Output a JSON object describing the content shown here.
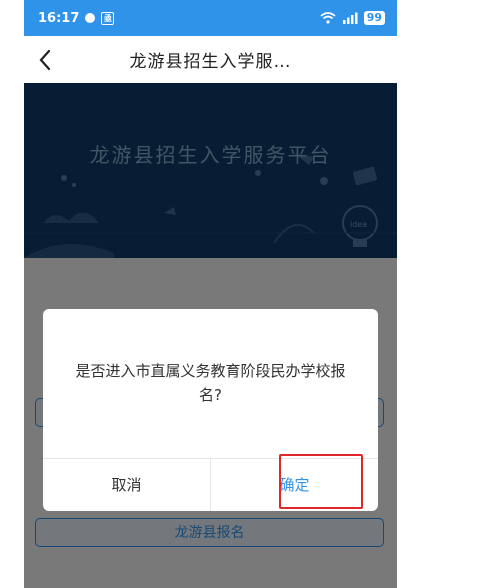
{
  "status_bar": {
    "time": "16:17",
    "app_badge": "亟",
    "signal": "4G",
    "battery": "99"
  },
  "navbar": {
    "title": "龙游县招生入学服…"
  },
  "banner": {
    "title": "龙游县招生入学服务平台",
    "bulb_text": "idea"
  },
  "content": {
    "bottom_button": "龙游县报名"
  },
  "dialog": {
    "message": "是否进入市直属义务教育阶段民办学校报名?",
    "cancel_label": "取消",
    "ok_label": "确定"
  },
  "colors": {
    "accent": "#2f93ea",
    "banner": "#0d3b66",
    "highlight": "#e3262b"
  }
}
